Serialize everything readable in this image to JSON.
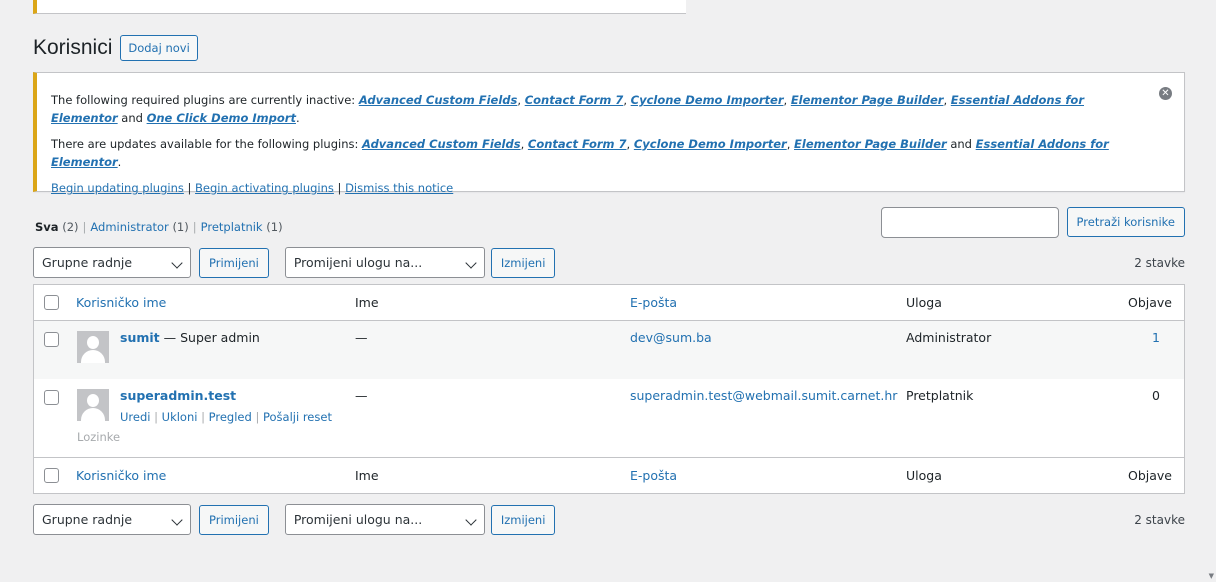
{
  "page": {
    "title": "Korisnici",
    "add_new_label": "Dodaj novi"
  },
  "notice": {
    "line1_prefix": "The following required plugins are currently inactive:",
    "line1_plugins": [
      "Advanced Custom Fields",
      "Contact Form 7",
      "Cyclone Demo Importer",
      "Elementor Page Builder",
      "Essential Addons for Elementor",
      "One Click Demo Import"
    ],
    "line2_prefix": "There are updates available for the following plugins:",
    "line2_plugins": [
      "Advanced Custom Fields",
      "Contact Form 7",
      "Cyclone Demo Importer",
      "Elementor Page Builder",
      "Essential Addons for Elementor"
    ],
    "and": "and",
    "actions": [
      "Begin updating plugins",
      "Begin activating plugins",
      "Dismiss this notice"
    ],
    "dismiss_icon": "close-circle-icon",
    "accent_color": "#dba617"
  },
  "filters": {
    "all_label": "Sva",
    "all_count": "(2)",
    "admin_label": "Administrator",
    "admin_count": "(1)",
    "sub_label": "Pretplatnik",
    "sub_count": "(1)"
  },
  "search": {
    "value": "",
    "button_label": "Pretraži korisnike"
  },
  "tablenav": {
    "bulk_select": "Grupne radnje",
    "apply_label": "Primijeni",
    "role_select": "Promijeni ulogu na...",
    "change_label": "Izmijeni",
    "count": "2 stavke"
  },
  "table": {
    "columns": [
      "Korisničko ime",
      "Ime",
      "E-pošta",
      "Uloga",
      "Objave"
    ],
    "rows": [
      {
        "username": "sumit",
        "suffix": "— Super admin",
        "name": "—",
        "email": "dev@sum.ba",
        "role": "Administrator",
        "posts": "1"
      },
      {
        "username": "superadmin.test",
        "suffix": "",
        "name": "—",
        "email": "superadmin.test@webmail.sumit.carnet.hr",
        "role": "Pretplatnik",
        "posts": "0",
        "actions": [
          "Uredi",
          "Ukloni",
          "Pregled",
          "Pošalji reset"
        ],
        "actions_wrap": "Lozinke"
      }
    ]
  },
  "colors": {
    "link": "#2271b1",
    "background": "#f0f0f1",
    "alt_row": "#f6f7f7"
  }
}
